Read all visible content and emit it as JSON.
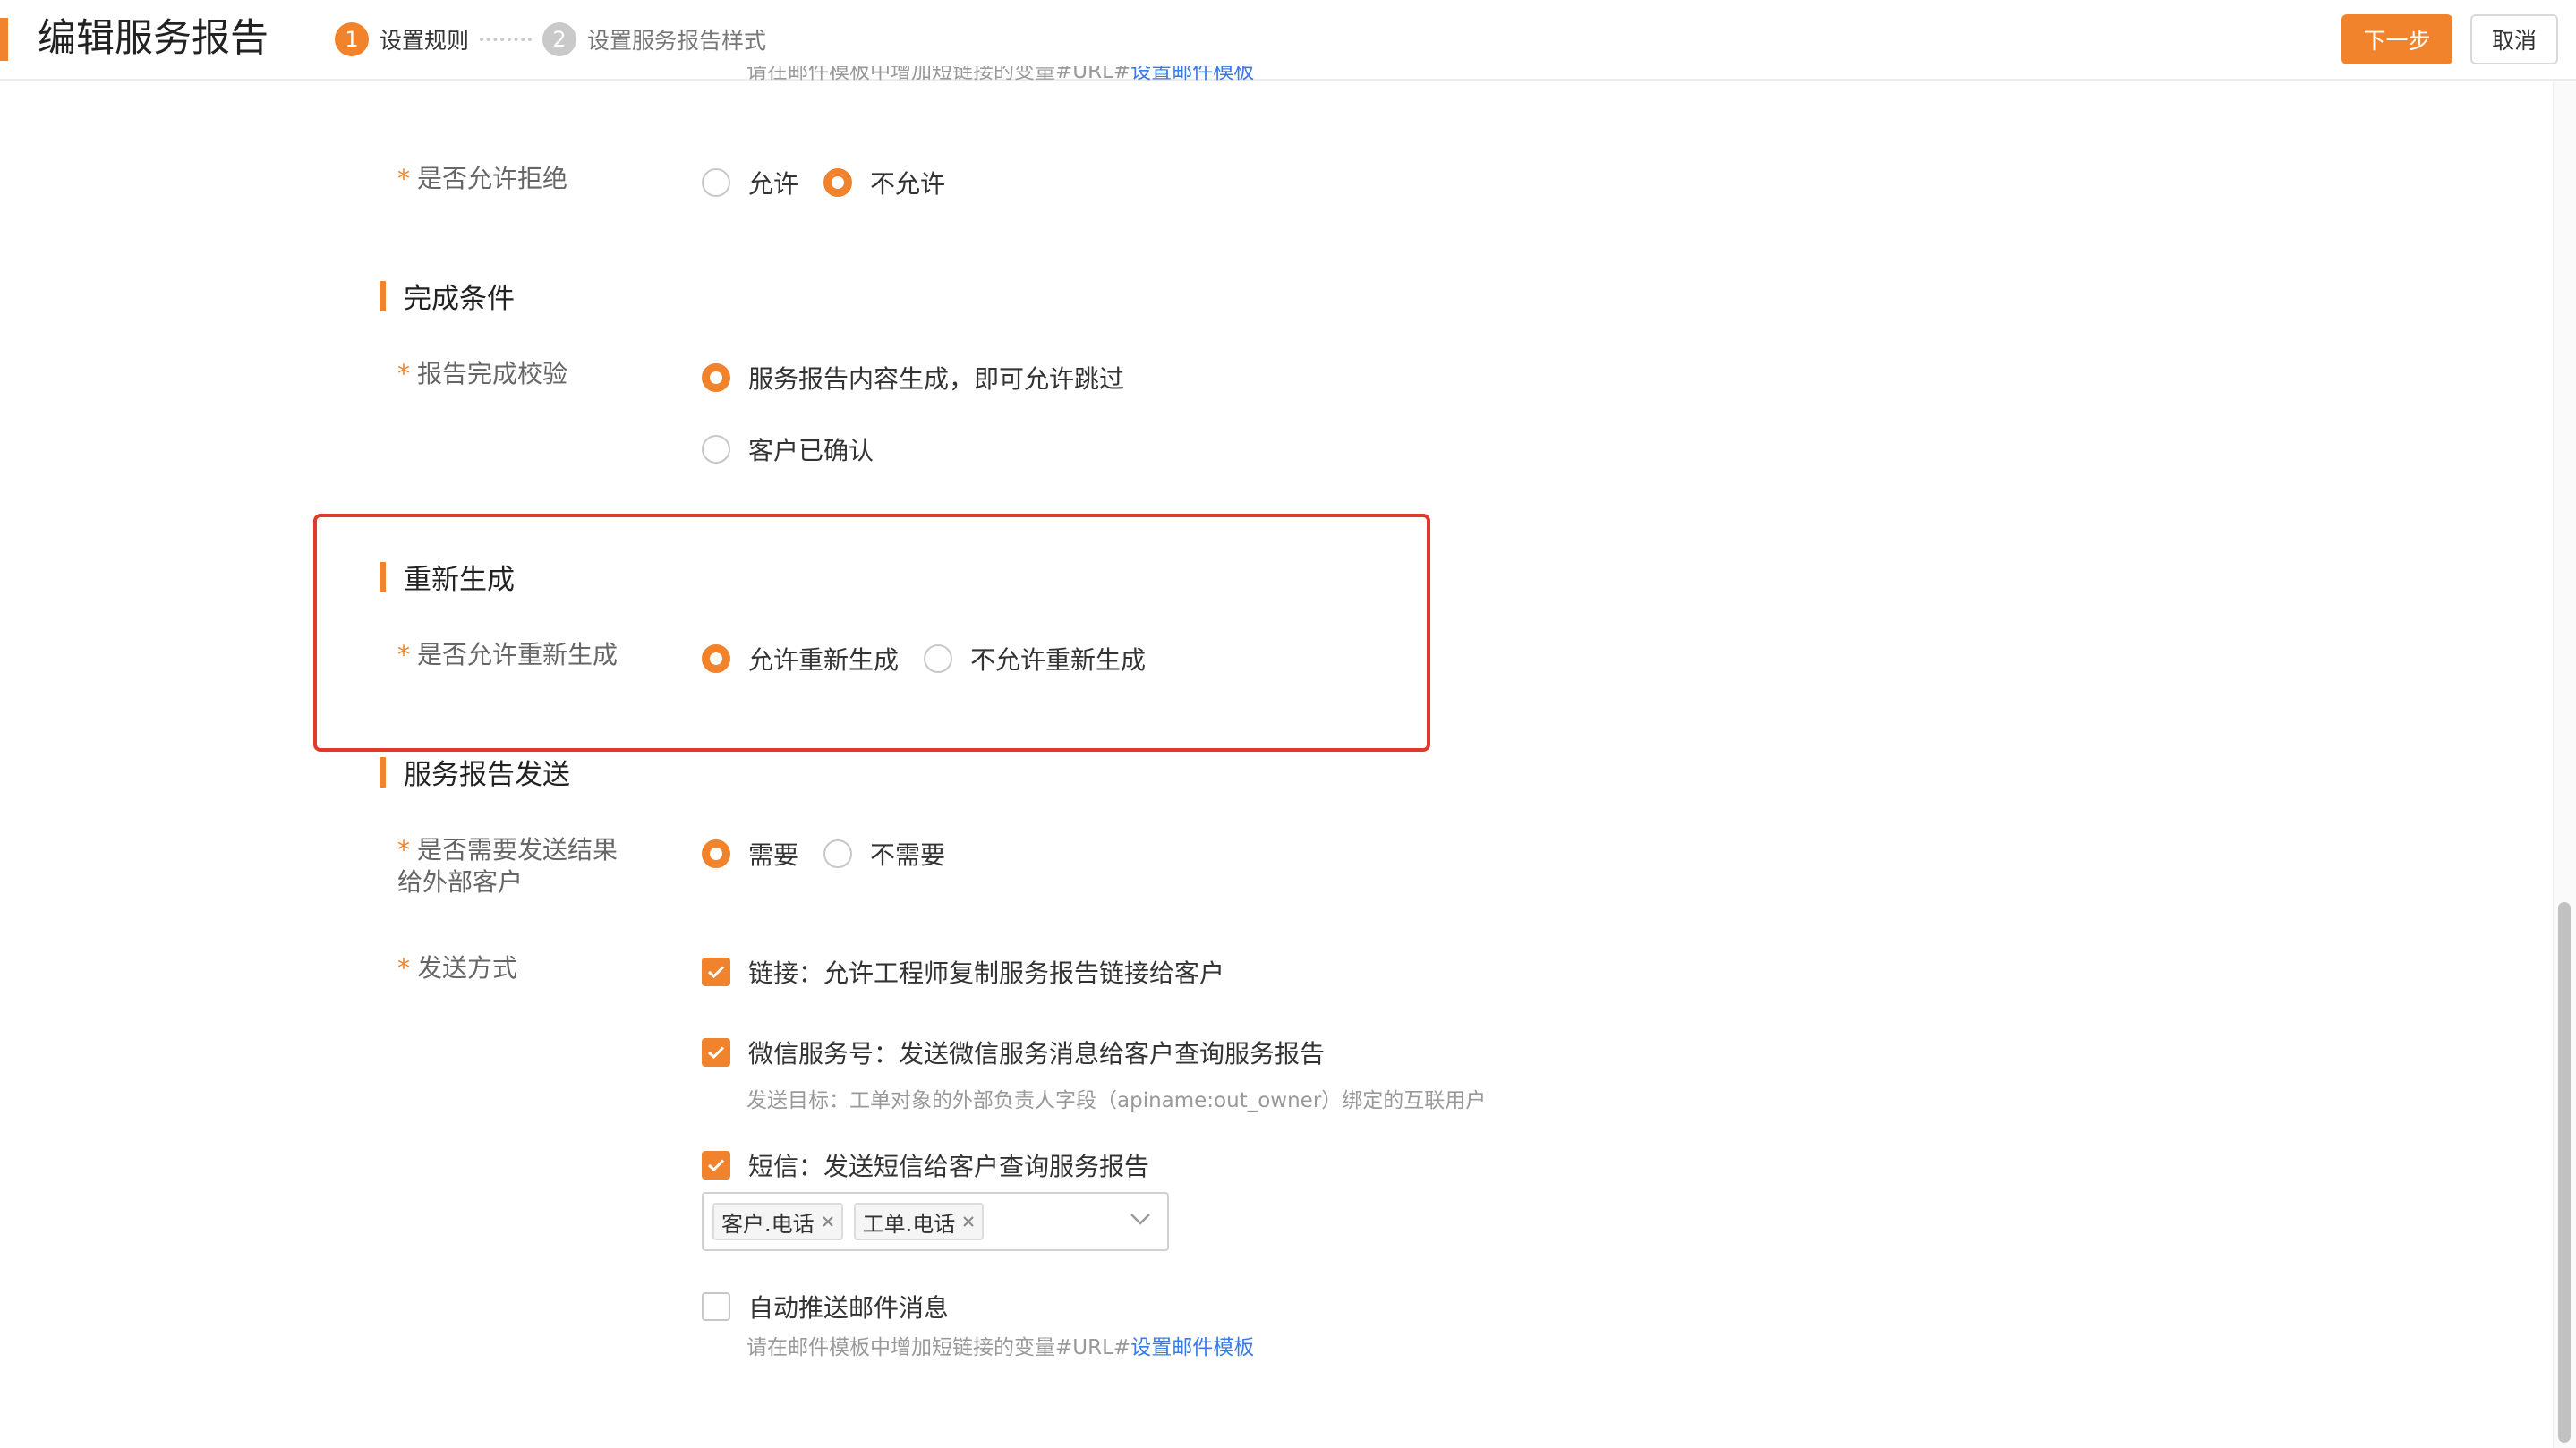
{
  "header": {
    "title": "编辑服务报告",
    "steps": [
      {
        "num": "1",
        "label": "设置规则"
      },
      {
        "num": "2",
        "label": "设置服务报告样式"
      }
    ],
    "next_button": "下一步",
    "cancel_button": "取消"
  },
  "top_note": {
    "text": "请在邮件模板中增加短链接的变量#URL#",
    "link": "设置邮件模板"
  },
  "reject": {
    "label": "是否允许拒绝",
    "options": [
      "允许",
      "不允许"
    ],
    "selected": "不允许"
  },
  "completion": {
    "section_title": "完成条件",
    "label": "报告完成校验",
    "options": [
      "服务报告内容生成，即可允许跳过",
      "客户已确认"
    ],
    "selected": "服务报告内容生成，即可允许跳过"
  },
  "regenerate": {
    "section_title": "重新生成",
    "label": "是否允许重新生成",
    "options": [
      "允许重新生成",
      "不允许重新生成"
    ],
    "selected": "允许重新生成"
  },
  "send": {
    "section_title": "服务报告发送",
    "need_label_line1": "是否需要发送结果",
    "need_label_line2": "给外部客户",
    "need_options": [
      "需要",
      "不需要"
    ],
    "need_selected": "需要",
    "method_label": "发送方式",
    "methods": [
      {
        "label": "链接：允许工程师复制服务报告链接给客户",
        "checked": true
      },
      {
        "label": "微信服务号：发送微信服务消息给客户查询服务报告",
        "checked": true
      },
      {
        "label": "短信：发送短信给客户查询服务报告",
        "checked": true
      },
      {
        "label": "自动推送邮件消息",
        "checked": false
      }
    ],
    "wechat_note": "发送目标：工单对象的外部负责人字段（apiname:out_owner）绑定的互联用户",
    "sms_tags": [
      "客户.电话",
      "工单.电话"
    ],
    "email_note": "请在邮件模板中增加短链接的变量#URL#",
    "email_note_link": "设置邮件模板"
  },
  "colors": {
    "accent": "#f0832c",
    "highlight": "#e13a2c",
    "link": "#3b7ae6"
  }
}
